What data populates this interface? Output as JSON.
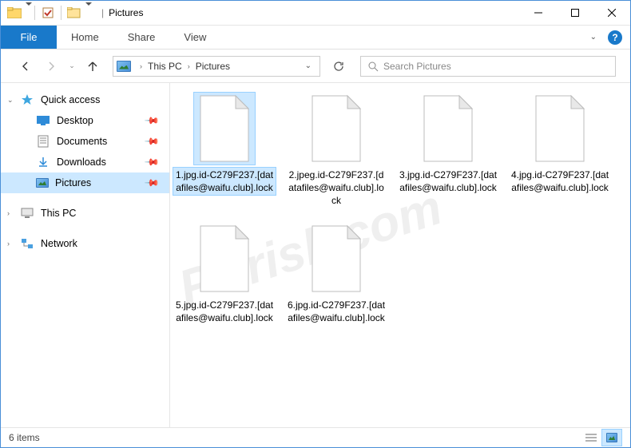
{
  "window": {
    "title": "Pictures"
  },
  "ribbon": {
    "file": "File",
    "tabs": [
      "Home",
      "Share",
      "View"
    ]
  },
  "nav": {
    "breadcrumb": [
      "This PC",
      "Pictures"
    ],
    "search_placeholder": "Search Pictures"
  },
  "sidebar": {
    "quick_access": "Quick access",
    "items": [
      {
        "label": "Desktop",
        "pinned": true
      },
      {
        "label": "Documents",
        "pinned": true
      },
      {
        "label": "Downloads",
        "pinned": true
      },
      {
        "label": "Pictures",
        "pinned": true,
        "selected": true
      }
    ],
    "this_pc": "This PC",
    "network": "Network"
  },
  "files": [
    {
      "name": "1.jpg.id-C279F237.[datafiles@waifu.club].lock",
      "selected": true
    },
    {
      "name": "2.jpeg.id-C279F237.[datafiles@waifu.club].lock"
    },
    {
      "name": "3.jpg.id-C279F237.[datafiles@waifu.club].lock"
    },
    {
      "name": "4.jpg.id-C279F237.[datafiles@waifu.club].lock"
    },
    {
      "name": "5.jpg.id-C279F237.[datafiles@waifu.club].lock"
    },
    {
      "name": "6.jpg.id-C279F237.[datafiles@waifu.club].lock"
    }
  ],
  "status": {
    "count_label": "6 items"
  },
  "watermark": {
    "text": "PCrisk.com"
  }
}
